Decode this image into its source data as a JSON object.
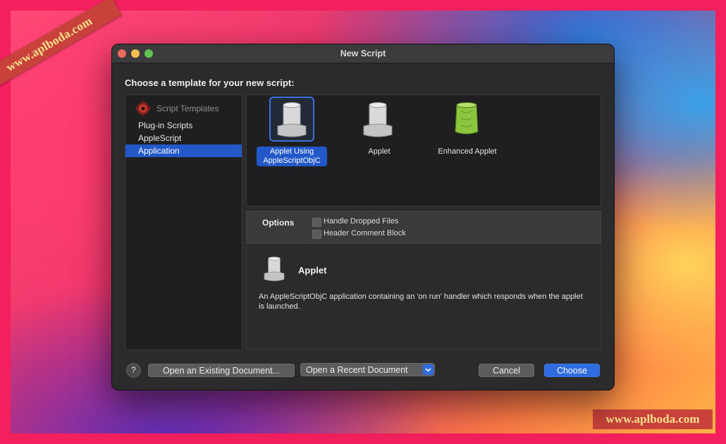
{
  "watermarks": {
    "corner_ribbon": "www.aplboda.com",
    "bottom_right": "www.aplboda.com"
  },
  "window": {
    "title": "New Script"
  },
  "prompt": "Choose a template for your new script:",
  "sidebar": {
    "header": "Script Templates",
    "items": [
      {
        "label": "Plug-in Scripts",
        "selected": false
      },
      {
        "label": "AppleScript",
        "selected": false
      },
      {
        "label": "Application",
        "selected": true
      }
    ]
  },
  "templates": [
    {
      "label_line1": "Applet Using",
      "label_line2": "AppleScriptObjC",
      "icon": "applet-scroll-icon",
      "selected": true
    },
    {
      "label_line1": "Applet",
      "label_line2": "",
      "icon": "applet-scroll-icon",
      "selected": false
    },
    {
      "label_line1": "Enhanced Applet",
      "label_line2": "",
      "icon": "green-scroll-icon",
      "selected": false
    }
  ],
  "options": {
    "title": "Options",
    "checkboxes": [
      {
        "label": "Handle Dropped Files",
        "checked": false
      },
      {
        "label": "Header Comment Block",
        "checked": false
      }
    ]
  },
  "description": {
    "title": "Applet",
    "text": "An AppleScriptObjC application containing an 'on run' handler which responds when the applet is launched."
  },
  "footer": {
    "help": "?",
    "open_existing": "Open an Existing Document...",
    "open_recent": "Open a Recent Document",
    "cancel": "Cancel",
    "choose": "Choose"
  },
  "colors": {
    "accent": "#2f6ce0",
    "selection": "#2358c9",
    "window_bg": "#2b2b2d"
  }
}
